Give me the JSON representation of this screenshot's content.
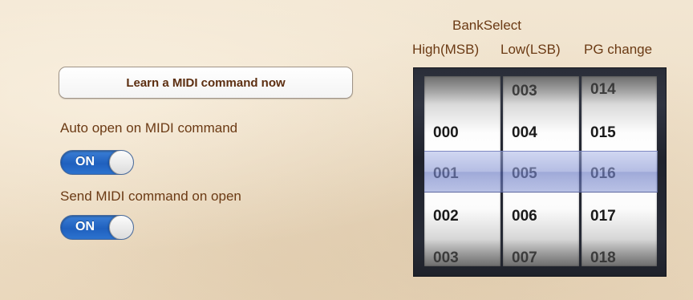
{
  "learn_button": {
    "label": "Learn a MIDI command now"
  },
  "settings": [
    {
      "label": "Auto open on MIDI command",
      "toggle": "ON"
    },
    {
      "label": "Send MIDI command on open",
      "toggle": "ON"
    }
  ],
  "bank_select": {
    "title": "BankSelect",
    "columns": [
      "High(MSB)",
      "Low(LSB)",
      "PG change"
    ]
  },
  "picker": {
    "wheels": [
      {
        "name": "msb",
        "rows": [
          "",
          "000",
          "001",
          "002",
          "003"
        ],
        "selected": "001"
      },
      {
        "name": "lsb",
        "rows": [
          "003",
          "004",
          "005",
          "006",
          "007"
        ],
        "selected": "005"
      },
      {
        "name": "pg",
        "rows": [
          "014",
          "015",
          "016",
          "017",
          "018"
        ],
        "selected": "016"
      }
    ]
  },
  "colors": {
    "label_brown": "#6b3a14",
    "toggle_blue": "#1f60be",
    "selection_blue": "#7887cd"
  },
  "icons": {
    "toggle_knob": "toggle-knob-icon"
  }
}
